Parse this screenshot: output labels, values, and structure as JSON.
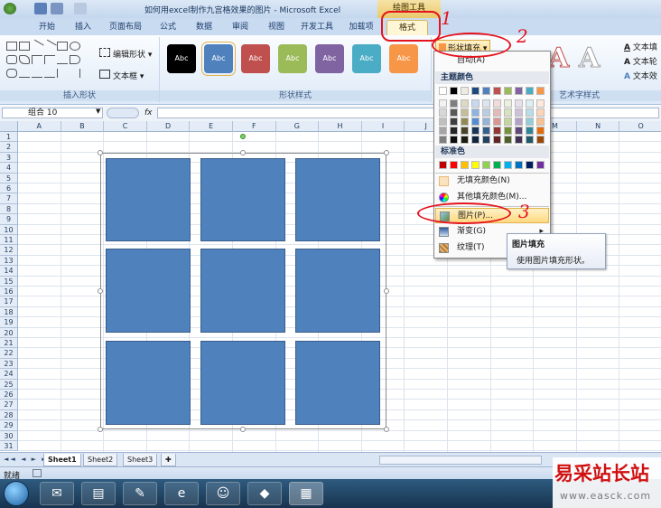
{
  "window": {
    "title": "如何用excel制作九宫格效果的图片 - Microsoft Excel",
    "context_tab": "绘图工具"
  },
  "tabs": [
    "开始",
    "插入",
    "页面布局",
    "公式",
    "数据",
    "审阅",
    "视图",
    "开发工具",
    "加载项",
    "格式"
  ],
  "active_tab": "格式",
  "ribbon": {
    "insert_shapes_label": "插入形状",
    "edit_shape": "编辑形状",
    "text_box": "文本框",
    "shape_styles_label": "形状样式",
    "style_thumbs": [
      {
        "text": "Abc",
        "color": "#000000"
      },
      {
        "text": "Abc",
        "color": "#4f81bd"
      },
      {
        "text": "Abc",
        "color": "#c0504d"
      },
      {
        "text": "Abc",
        "color": "#9bbb59"
      },
      {
        "text": "Abc",
        "color": "#8064a2"
      },
      {
        "text": "Abc",
        "color": "#4bacc6"
      },
      {
        "text": "Abc",
        "color": "#f79646"
      }
    ],
    "shape_fill_button": "形状填充",
    "wordart_label": "艺术字样式",
    "text_fill": "文本填",
    "text_outline": "文本轮",
    "text_effect": "文本效"
  },
  "formula_bar": {
    "name_box": "组合 10",
    "fx": "fx"
  },
  "columns": [
    "A",
    "B",
    "C",
    "D",
    "E",
    "F",
    "G",
    "H",
    "I",
    "J",
    "K",
    "L",
    "M",
    "N",
    "O"
  ],
  "rows": [
    "1",
    "2",
    "3",
    "4",
    "5",
    "6",
    "7",
    "8",
    "9",
    "10",
    "11",
    "12",
    "13",
    "14",
    "15",
    "16",
    "17",
    "18",
    "19",
    "20",
    "21",
    "22",
    "23",
    "24",
    "25",
    "26",
    "27",
    "28",
    "29",
    "30",
    "31"
  ],
  "fill_menu": {
    "auto": "自动(A)",
    "theme_colors_header": "主题颜色",
    "theme_colors": [
      [
        "#ffffff",
        "#000000",
        "#eeece1",
        "#1f497d",
        "#4f81bd",
        "#c0504d",
        "#9bbb59",
        "#8064a2",
        "#4bacc6",
        "#f79646"
      ],
      [
        "#f2f2f2",
        "#7f7f7f",
        "#ddd9c3",
        "#c6d9f0",
        "#dbe5f1",
        "#f2dcdb",
        "#ebf1dd",
        "#e5e0ec",
        "#dbeef3",
        "#fdeada"
      ],
      [
        "#d8d8d8",
        "#595959",
        "#c4bd97",
        "#8db3e2",
        "#b8cce4",
        "#e5b9b7",
        "#d7e3bc",
        "#ccc1d9",
        "#b7dde8",
        "#fbd5b5"
      ],
      [
        "#bfbfbf",
        "#3f3f3f",
        "#938953",
        "#548dd4",
        "#95b3d7",
        "#d99694",
        "#c3d69b",
        "#b2a2c7",
        "#92cddc",
        "#fac08f"
      ],
      [
        "#a5a5a5",
        "#262626",
        "#494429",
        "#17365d",
        "#366092",
        "#953734",
        "#76923c",
        "#5f497a",
        "#31859b",
        "#e36c09"
      ],
      [
        "#7f7f7f",
        "#0c0c0c",
        "#1d1b10",
        "#0f243e",
        "#244061",
        "#632423",
        "#4f6128",
        "#3f3151",
        "#205867",
        "#974806"
      ]
    ],
    "standard_colors_header": "标准色",
    "standard_colors": [
      "#c00000",
      "#ff0000",
      "#ffc000",
      "#ffff00",
      "#92d050",
      "#00b050",
      "#00b0f0",
      "#0070c0",
      "#002060",
      "#7030a0"
    ],
    "no_fill": "无填充颜色(N)",
    "more_colors": "其他填充颜色(M)...",
    "picture": "图片(P)...",
    "gradient": "渐变(G)",
    "texture": "纹理(T)"
  },
  "tooltip": {
    "title": "图片填充",
    "description": "使用图片填充形状。"
  },
  "sheets": [
    "Sheet1",
    "Sheet2",
    "Sheet3"
  ],
  "status": "就绪",
  "annotations": [
    "1",
    "2",
    "3"
  ],
  "watermark": {
    "title": "易采站长站",
    "url": "www.easck.com"
  }
}
